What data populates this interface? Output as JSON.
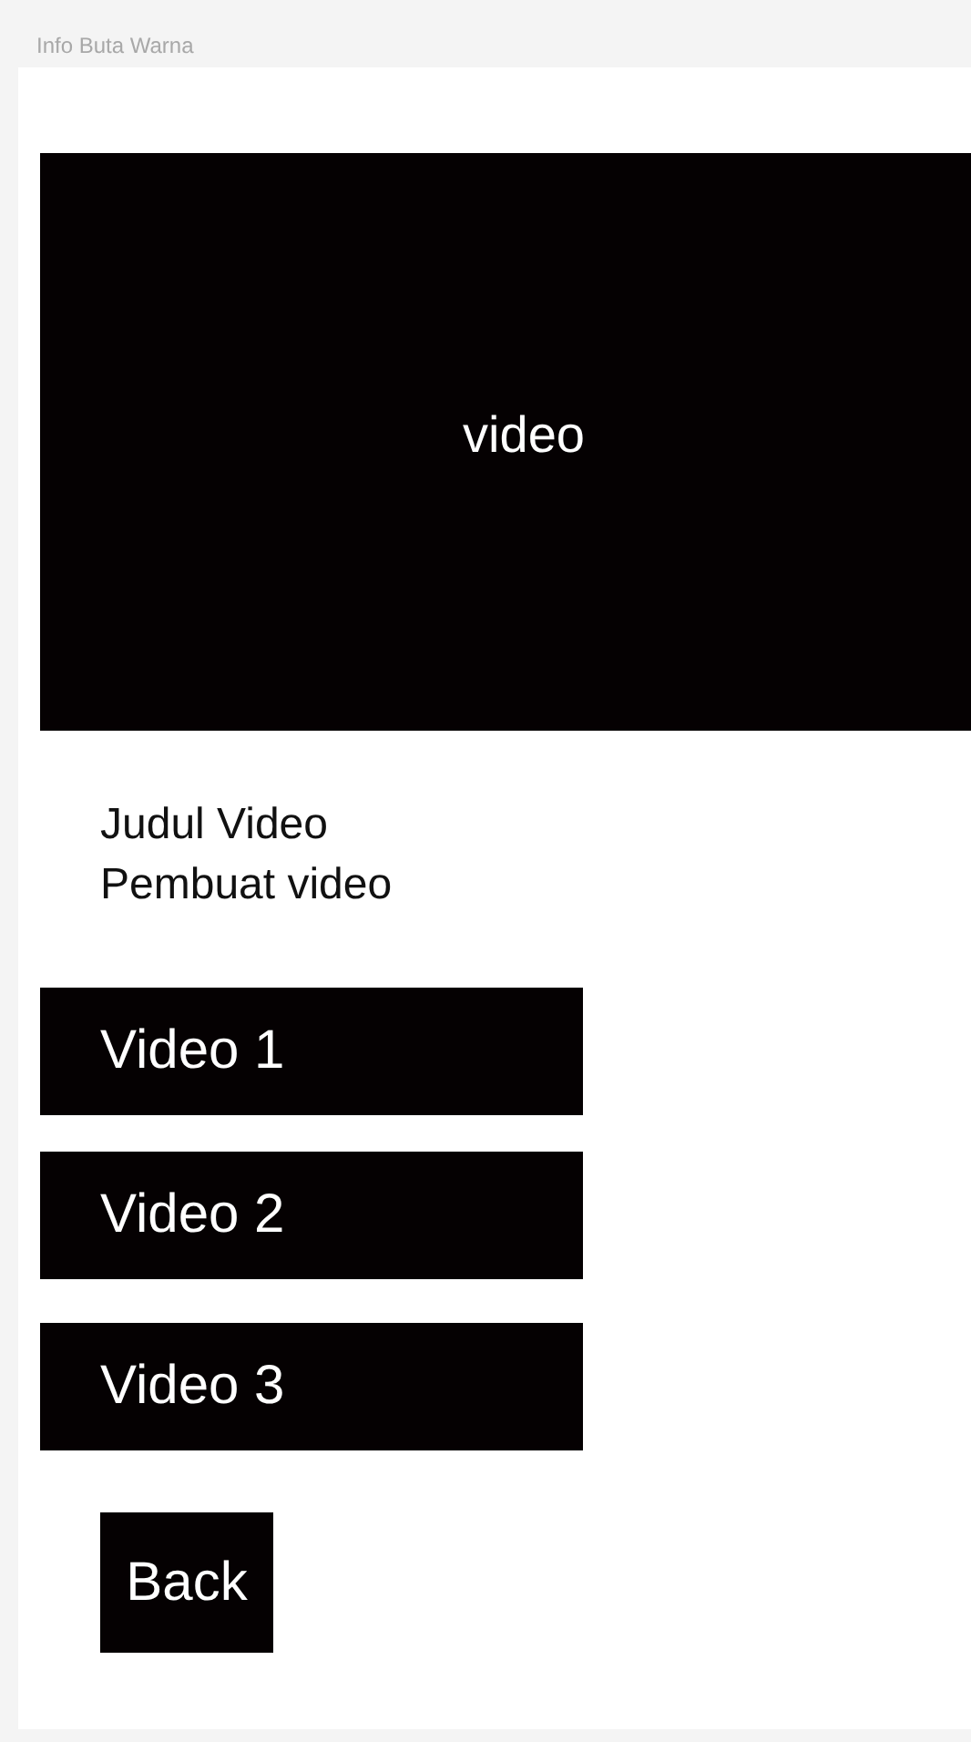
{
  "frame_label": "Info Buta Warna",
  "video_player": {
    "label": "video"
  },
  "video_info": {
    "title": "Judul Video",
    "creator": "Pembuat video"
  },
  "video_list": [
    "Video 1",
    "Video 2",
    "Video 3"
  ],
  "back_button": "Back"
}
